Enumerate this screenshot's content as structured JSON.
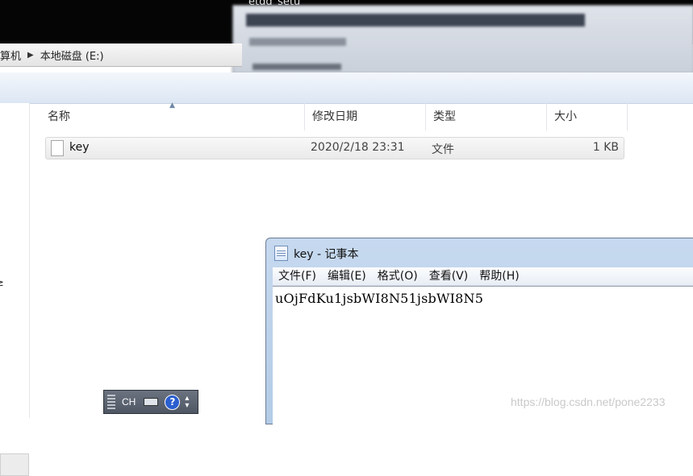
{
  "background_window": {
    "title_fragment": "etdd_setu"
  },
  "explorer": {
    "breadcrumb": {
      "parent_fragment": "算机",
      "current": "本地磁盘 (E:)"
    },
    "nav_fragment": "≥",
    "columns": {
      "name": "名称",
      "date": "修改日期",
      "type": "类型",
      "size": "大小"
    },
    "files": [
      {
        "name": "key",
        "date": "2020/2/18 23:31",
        "type": "文件",
        "size": "1 KB"
      }
    ]
  },
  "notepad": {
    "title": "key - 记事本",
    "menu": [
      "文件(F)",
      "编辑(E)",
      "格式(O)",
      "查看(V)",
      "帮助(H)"
    ],
    "content": "uOjFdKu1jsbWI8N51jsbWI8N5"
  },
  "language_bar": {
    "input_language": "CH",
    "help_symbol": "?"
  },
  "watermark": "https://blog.csdn.net/pone2233",
  "colors": {
    "toolbar": "#dce6f3",
    "notepad_frame": "#b3cbe6",
    "help_button": "#2b5fcf"
  }
}
